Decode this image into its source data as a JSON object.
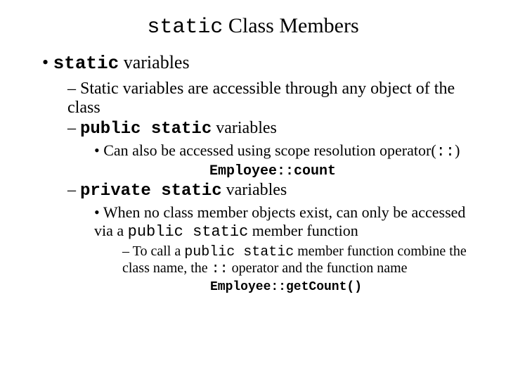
{
  "title": {
    "code": "static",
    "rest": " Class Members"
  },
  "lvl1": {
    "item1": {
      "code": "static",
      "rest": " variables"
    }
  },
  "lvl2": {
    "item1": "Static variables are accessible through any object of the class",
    "item2": {
      "code": "public static",
      "rest": " variables"
    },
    "item3": {
      "code": "private static",
      "rest": " variables"
    }
  },
  "lvl3": {
    "item1": {
      "pre": "Can also be accessed using scope resolution operator(",
      "code": "::",
      "post": ")"
    },
    "item2": {
      "pre": "When no class member objects exist, can only be accessed via a ",
      "code": "public static",
      "post": " member function"
    }
  },
  "lvl4": {
    "item1": {
      "pre": "To call a ",
      "code": "public static",
      "mid": " member function combine the class name, the ",
      "code2": "::",
      "post": " operator and the function name"
    }
  },
  "codeblocks": {
    "c1": "Employee::count",
    "c2": "Employee::getCount()"
  }
}
